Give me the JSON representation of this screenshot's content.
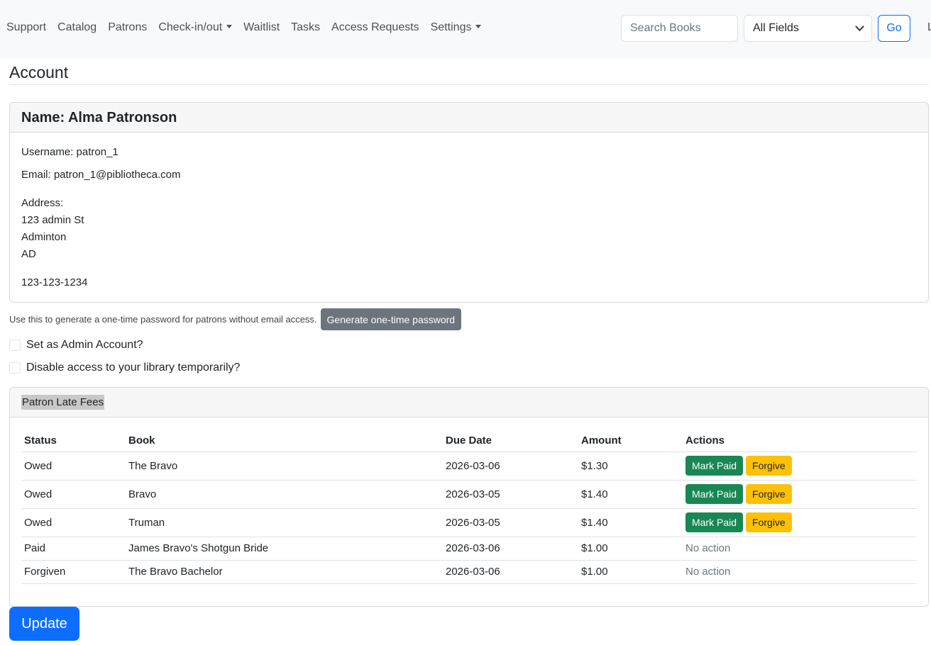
{
  "nav": {
    "links": [
      "Support",
      "Catalog",
      "Patrons",
      "Check-in/out",
      "Waitlist",
      "Tasks",
      "Access Requests",
      "Settings"
    ],
    "search_placeholder": "Search Books",
    "field_select": "All Fields",
    "go_label": "Go",
    "cut_text": "L"
  },
  "page": {
    "title": "Account"
  },
  "profile": {
    "name": "Name: Alma Patronson",
    "username": "Username: patron_1",
    "email": "Email: patron_1@pibliotheca.com",
    "address_label": "Address:",
    "address_line1": "123 admin St",
    "address_line2": "Adminton",
    "address_line3": "AD",
    "phone": "123-123-1234"
  },
  "otp": {
    "help": "Use this to generate a one-time password for patrons without email access.",
    "button": "Generate one-time password"
  },
  "options": {
    "admin": "Set as Admin Account?",
    "disable": "Disable access to your library temporarily?"
  },
  "fees": {
    "header": "Patron Late Fees",
    "columns": [
      "Status",
      "Book",
      "Due Date",
      "Amount",
      "Actions"
    ],
    "mark_paid_label": "Mark Paid",
    "forgive_label": "Forgive",
    "no_action_label": "No action",
    "rows": [
      {
        "status": "Owed",
        "book": "The Bravo",
        "due": "2026-03-06",
        "amount": "$1.30"
      },
      {
        "status": "Owed",
        "book": "Bravo",
        "due": "2026-03-05",
        "amount": "$1.40"
      },
      {
        "status": "Owed",
        "book": "Truman",
        "due": "2026-03-05",
        "amount": "$1.40"
      },
      {
        "status": "Paid",
        "book": "James Bravo's Shotgun Bride",
        "due": "2026-03-06",
        "amount": "$1.00"
      },
      {
        "status": "Forgiven",
        "book": "The Bravo Bachelor",
        "due": "2026-03-06",
        "amount": "$1.00"
      }
    ]
  },
  "update_label": "Update"
}
